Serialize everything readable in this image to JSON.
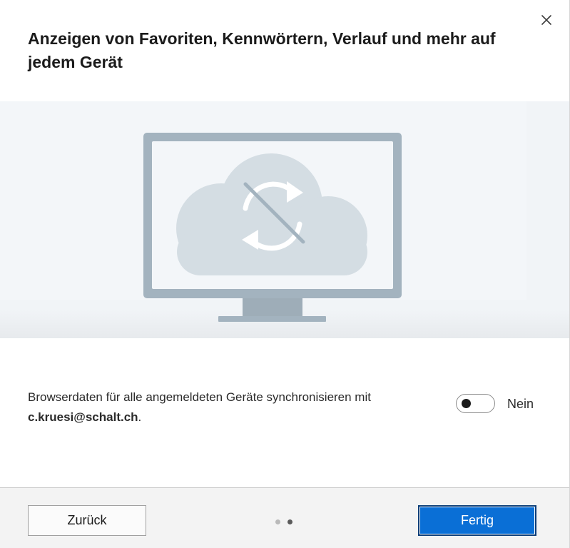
{
  "dialog": {
    "title": "Anzeigen von Favoriten, Kennwörtern, Verlauf und mehr auf jedem Gerät",
    "close_icon": "close-icon"
  },
  "illustration": {
    "icon": "monitor-cloud-sync-off-illustration",
    "colors": {
      "background": "#f3f6f9",
      "monitor_frame": "#a3b3bf",
      "screen": "#f3f6f9",
      "cloud": "#d4dde3",
      "sync_symbol": "#ffffff",
      "strike": "#a3b3bf"
    }
  },
  "sync": {
    "text_prefix": "Browserdaten für alle angemeldeten Geräte synchronisieren mit ",
    "email": "c.kruesi@schalt.ch",
    "text_suffix": ".",
    "toggle_on": false,
    "toggle_state_label": "Nein"
  },
  "footer": {
    "back_label": "Zurück",
    "done_label": "Fertig",
    "pager": {
      "total": 2,
      "current": 2
    }
  },
  "colors": {
    "accent": "#0a6fd6",
    "footer_background": "#f3f3f3"
  }
}
